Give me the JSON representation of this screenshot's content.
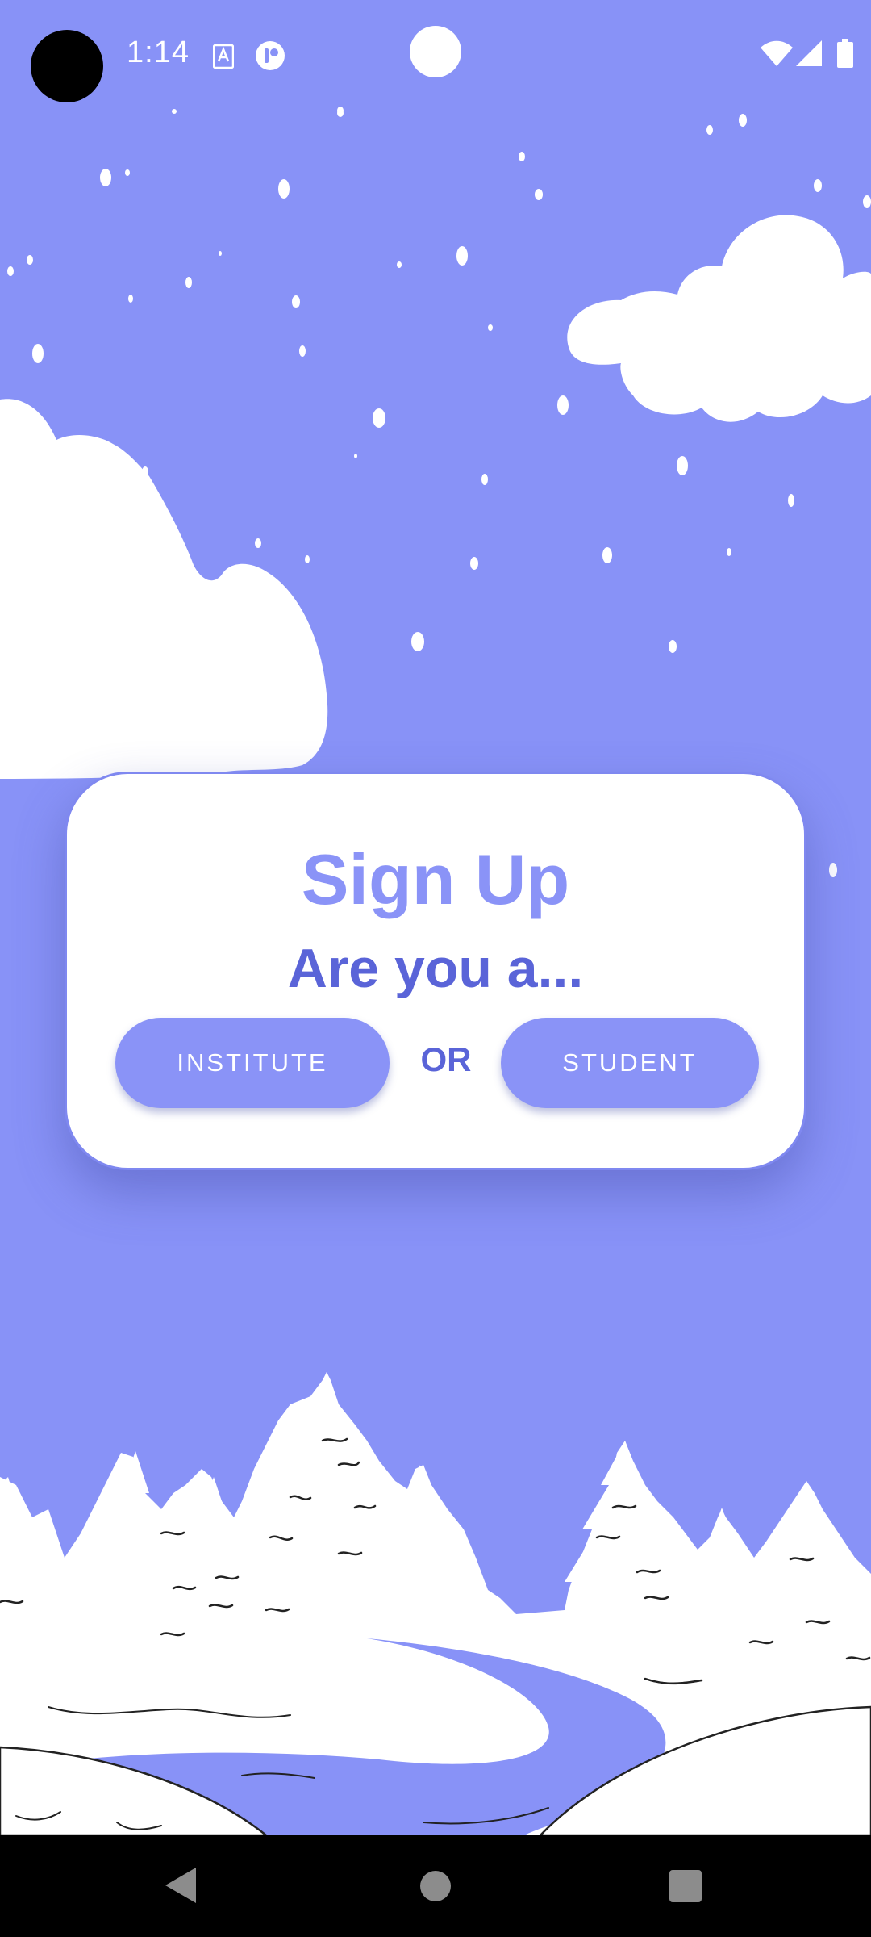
{
  "status_bar": {
    "time": "1:14",
    "icons": [
      "text-recognition-icon",
      "app-notification-icon",
      "wifi-icon",
      "cellular-signal-icon",
      "battery-icon"
    ]
  },
  "signup_dialog": {
    "title": "Sign Up",
    "subtitle": "Are you a...",
    "institute_button_label": "INSTITUTE",
    "or_label": "OR",
    "student_button_label": "STUDENT"
  },
  "navigation_bar": {
    "icons": [
      "back-icon",
      "home-icon",
      "recents-icon"
    ]
  },
  "colors": {
    "background": "#8892f7",
    "accent": "#8a93f7",
    "accent_dark": "#5a64d8",
    "card": "#ffffff",
    "button_text": "#ffffff",
    "nav_bar": "#000000"
  }
}
